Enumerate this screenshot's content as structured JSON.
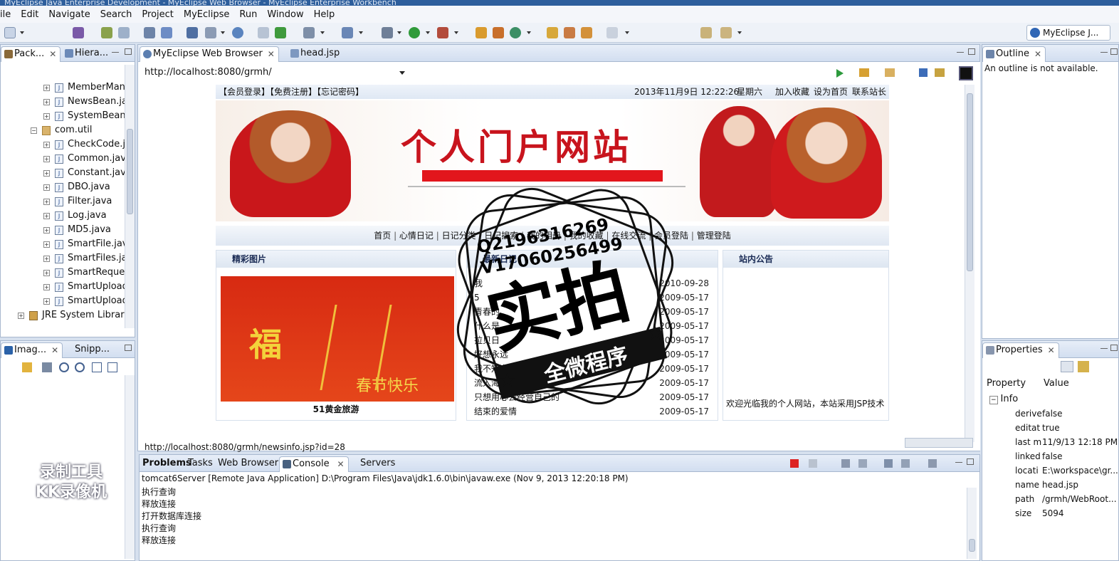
{
  "window": {
    "title": "MyEclipse Java Enterprise Development - MyEclipse Web Browser - MyEclipse Enterprise Workbench"
  },
  "menu": [
    "ile",
    "Edit",
    "Navigate",
    "Search",
    "Project",
    "MyEclipse",
    "Run",
    "Window",
    "Help"
  ],
  "perspective": {
    "label": "MyEclipse J..."
  },
  "left_panel": {
    "tabs": [
      "Pack...",
      "Hiera..."
    ],
    "tree": [
      {
        "label": "MemberMan",
        "kind": "java"
      },
      {
        "label": "NewsBean.jav",
        "kind": "java"
      },
      {
        "label": "SystemBean.j",
        "kind": "java"
      },
      {
        "label": "com.util",
        "kind": "package"
      },
      {
        "label": "CheckCode.ja",
        "kind": "java"
      },
      {
        "label": "Common.java",
        "kind": "java"
      },
      {
        "label": "Constant.java",
        "kind": "java"
      },
      {
        "label": "DBO.java",
        "kind": "java"
      },
      {
        "label": "Filter.java",
        "kind": "java"
      },
      {
        "label": "Log.java",
        "kind": "java"
      },
      {
        "label": "MD5.java",
        "kind": "java"
      },
      {
        "label": "SmartFile.java",
        "kind": "java"
      },
      {
        "label": "SmartFiles.jav",
        "kind": "java"
      },
      {
        "label": "SmartReques",
        "kind": "java"
      },
      {
        "label": "SmartUpload",
        "kind": "java"
      },
      {
        "label": "SmartUpload",
        "kind": "java"
      },
      {
        "label": "JRE System Library",
        "kind": "library"
      }
    ]
  },
  "image_panel": {
    "tabs": [
      "Imag...",
      "Snipp..."
    ]
  },
  "editor": {
    "tabs": [
      {
        "label": "MyEclipse Web Browser",
        "active": true
      },
      {
        "label": "head.jsp",
        "active": false
      }
    ],
    "url": "http://localhost:8080/grmh/",
    "status_url": "http://localhost:8080/grmh/newsinfo.jsp?id=28"
  },
  "website": {
    "top_links": "【会员登录】【免费注册】【忘记密码】",
    "datetime": "2013年11月9日 12:22:26",
    "weekday": "星期六",
    "right_links": [
      "加入收藏",
      "设为首页",
      "联系站长"
    ],
    "banner_title": "个人门户网站",
    "nav": [
      "首页",
      "心情日记",
      "日记分类",
      "日记搜索",
      "我的相册",
      "我的收藏",
      "在线交流",
      "会员登陆",
      "管理登陆"
    ],
    "box_pictures": {
      "title": "精彩图片",
      "caption": "51黄金旅游",
      "image_text": "福",
      "image_sub": "春节快乐"
    },
    "box_diary": {
      "title": "最新日记",
      "items": [
        {
          "title": "我",
          "date": "2010-09-28"
        },
        {
          "title": "5",
          "date": "2009-05-17"
        },
        {
          "title": "青春的",
          "date": "2009-05-17"
        },
        {
          "title": "什么是",
          "date": "2009-05-17"
        },
        {
          "title": "拉贝日",
          "date": "2009-05-17"
        },
        {
          "title": "好想永远",
          "date": "2009-05-17"
        },
        {
          "title": "我不知道这",
          "date": "2009-05-17"
        },
        {
          "title": "流入海底的",
          "date": "2009-05-17"
        },
        {
          "title": "只想用心去经营自己的",
          "date": "2009-05-17"
        },
        {
          "title": "结束的爱情",
          "date": "2009-05-17"
        }
      ]
    },
    "box_notice": {
      "title": "站内公告",
      "text": "欢迎光临我的个人网站，本站采用JSP技术"
    }
  },
  "stamp": {
    "qq": "Q2196316269",
    "wx": "V17060256499",
    "big": "实拍",
    "band": "全微程序"
  },
  "console": {
    "tabs": [
      "Problems",
      "Tasks",
      "Web Browser",
      "Console",
      "Servers"
    ],
    "header": "tomcat6Server [Remote Java Application] D:\\Program Files\\Java\\jdk1.6.0\\bin\\javaw.exe (Nov 9, 2013 12:20:18 PM)",
    "lines": [
      "执行查询",
      "释放连接",
      "打开数据库连接",
      "执行查询",
      "释放连接"
    ]
  },
  "outline": {
    "tab": "Outline",
    "message": "An outline is not available."
  },
  "properties": {
    "tab": "Properties",
    "col_property": "Property",
    "col_value": "Value",
    "group": "Info",
    "rows": [
      {
        "k": "derive",
        "v": "false"
      },
      {
        "k": "editat",
        "v": "true"
      },
      {
        "k": "last m",
        "v": "11/9/13 12:18 PM"
      },
      {
        "k": "linked",
        "v": "false"
      },
      {
        "k": "locati",
        "v": "E:\\workspace\\gr..."
      },
      {
        "k": "name",
        "v": "head.jsp"
      },
      {
        "k": "path",
        "v": "/grmh/WebRoot..."
      },
      {
        "k": "size",
        "v": "5094"
      }
    ]
  },
  "watermark": {
    "line1": "录制工具",
    "line2": "KK录像机"
  }
}
